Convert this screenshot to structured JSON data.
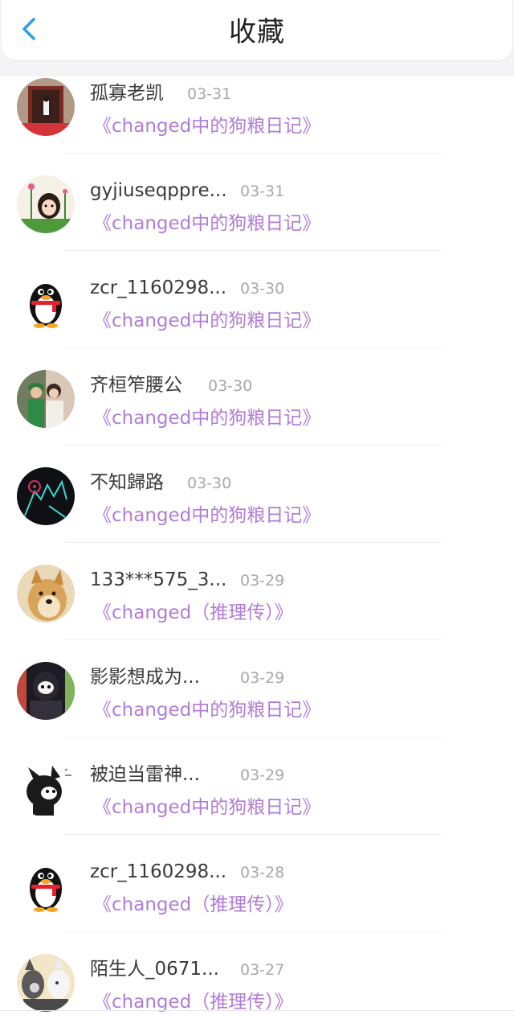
{
  "header": {
    "title": "收藏"
  },
  "favorites": [
    {
      "name": "孤寡老凯",
      "date": "03-31",
      "work": "《changed中的狗粮日记》",
      "avatar": "photo-doorway-avatar"
    },
    {
      "name": "gyjiuseqppre...",
      "date": "03-31",
      "work": "《changed中的狗粮日记》",
      "avatar": "cartoon-girl-flowers-avatar"
    },
    {
      "name": "zcr_1160298...",
      "date": "03-30",
      "work": "《changed中的狗粮日记》",
      "avatar": "qq-penguin-avatar"
    },
    {
      "name": "齐桓笮腰公",
      "date": "03-30",
      "work": "《changed中的狗粮日记》",
      "avatar": "photo-two-people-avatar"
    },
    {
      "name": "不知歸路",
      "date": "03-30",
      "work": "《changed中的狗粮日记》",
      "avatar": "dark-creature-avatar"
    },
    {
      "name": "133***575_3...",
      "date": "03-29",
      "work": "《changed（推理传）》",
      "avatar": "doge-avatar"
    },
    {
      "name": "影影想成为...",
      "date": "03-29",
      "work": "《changed中的狗粮日记》",
      "avatar": "masked-character-avatar"
    },
    {
      "name": "被迫当雷神...",
      "date": "03-29",
      "work": "《changed中的狗粮日记》",
      "avatar": "black-wolf-avatar"
    },
    {
      "name": "zcr_1160298...",
      "date": "03-28",
      "work": "《changed（推理传）》",
      "avatar": "qq-penguin-avatar"
    },
    {
      "name": "陌生人_0671...",
      "date": "03-27",
      "work": "《changed（推理传）》",
      "avatar": "wolf-pair-avatar"
    }
  ],
  "colors": {
    "accent_blue": "#2f9bf0",
    "work_link_purple": "#b07cd8",
    "name_text": "#3a3a3a",
    "date_text": "#a8a8a8"
  }
}
